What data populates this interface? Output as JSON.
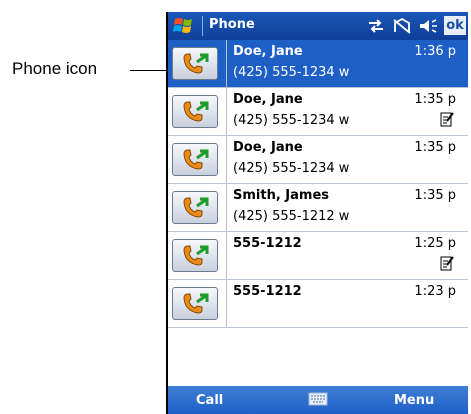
{
  "callout": {
    "label": "Phone icon"
  },
  "titlebar": {
    "app_title": "Phone",
    "ok_label": "ok"
  },
  "calls": [
    {
      "name": "Doe, Jane",
      "number": "(425) 555-1234 w",
      "time": "1:36 p",
      "note": false,
      "selected": true
    },
    {
      "name": "Doe, Jane",
      "number": "(425) 555-1234 w",
      "time": "1:35 p",
      "note": true,
      "selected": false
    },
    {
      "name": "Doe, Jane",
      "number": "(425) 555-1234 w",
      "time": "1:35 p",
      "note": false,
      "selected": false
    },
    {
      "name": "Smith, James",
      "number": "(425) 555-1212 w",
      "time": "1:35 p",
      "note": false,
      "selected": false
    },
    {
      "name": "555-1212",
      "number": "",
      "time": "1:25 p",
      "note": true,
      "selected": false
    },
    {
      "name": "555-1212",
      "number": "",
      "time": "1:23 p",
      "note": false,
      "selected": false
    }
  ],
  "menubar": {
    "left_soft_key": "Call",
    "right_soft_key": "Menu"
  },
  "colors": {
    "title_bar": "#1a57b8",
    "selection": "#1e5fc6",
    "menu_bar": "#3f7fd6"
  },
  "icons": [
    "windows-start-icon",
    "connectivity-icon",
    "signal-off-icon",
    "speaker-icon",
    "phone-call-icon",
    "note-icon",
    "keyboard-icon"
  ]
}
